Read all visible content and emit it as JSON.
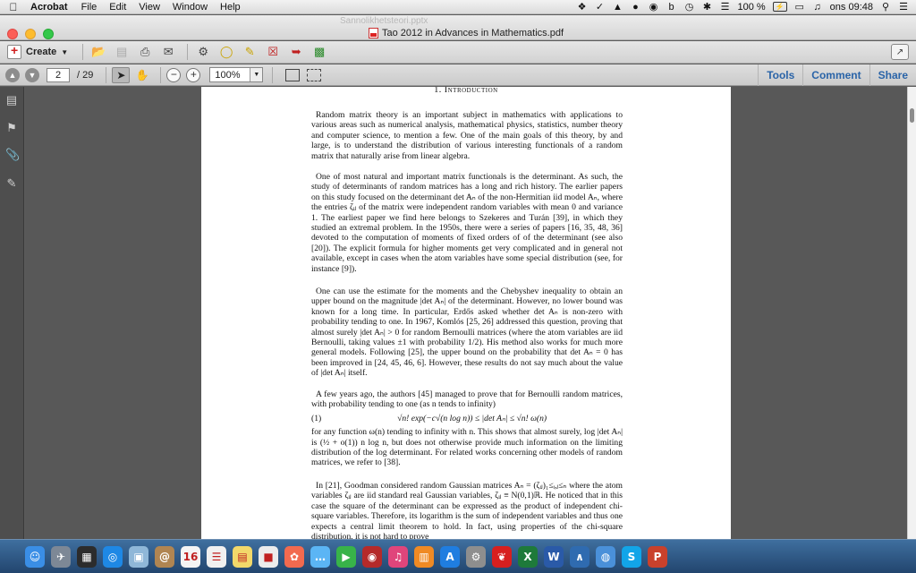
{
  "menubar": {
    "app_name": "Acrobat",
    "menus": [
      "File",
      "Edit",
      "View",
      "Window",
      "Help"
    ],
    "status": {
      "battery": "100 %",
      "battery_badge": "⚡",
      "clock": "ons 09:48"
    }
  },
  "window": {
    "ghost_title": "Sannolikhetsteori.pptx",
    "title": "Tao 2012 in Advances in Mathematics.pdf"
  },
  "toolbar": {
    "create_label": "Create",
    "tools": [
      "open-folder-icon",
      "save-icon",
      "print-icon",
      "email-icon",
      "gear-icon",
      "comment-icon",
      "sign-icon",
      "pdf-delete-icon",
      "pdf-export-icon",
      "pdf-combine-icon"
    ]
  },
  "nav": {
    "current_page": "2",
    "page_total": "/ 29",
    "zoom": "100%",
    "right_tabs": [
      "Tools",
      "Comment",
      "Share"
    ]
  },
  "document": {
    "heading": "1. Introduction",
    "p1": "Random matrix theory is an important subject in mathematics with applications to various areas such as numerical analysis, mathematical physics, statistics, number theory and computer science, to mention a few. One of the main goals of this theory, by and large, is to understand the distribution of various interesting functionals of a random matrix that naturally arise from linear algebra.",
    "p2": "One of most natural and important matrix functionals is the determinant. As such, the study of determinants of random matrices has a long and rich history. The earlier papers on this study focused on the determinant det Aₙ of the non-Hermitian iid model Aₙ, where the entries ζᵢⱼ of the matrix were independent random variables with mean 0 and variance 1. The earliest paper we find here belongs to Szekeres and Turán [39], in which they studied an extremal problem. In the 1950s, there were a series of papers [16, 35, 48, 36] devoted to the computation of moments of fixed orders of of the determinant (see also [20]). The explicit formula for higher moments get very complicated and in general not available, except in cases when the atom variables have some special distribution (see, for instance [9]).",
    "p3": "One can use the estimate for the moments and the Chebyshev inequality to obtain an upper bound on the magnitude |det Aₙ| of the determinant. However, no lower bound was known for a long time. In particular, Erdős asked whether det Aₙ is non-zero with probability tending to one. In 1967, Komlós [25, 26] addressed this question, proving that almost surely |det Aₙ| > 0 for random Bernoulli matrices (where the atom variables are iid Bernoulli, taking values ±1 with probability 1/2). His method also works for much more general models. Following [25], the upper bound on the probability that det Aₙ = 0 has been improved in [24, 45, 46, 6]. However, these results do not say much about the value of |det Aₙ| itself.",
    "p4_intro": "A few years ago, the authors [45] managed to prove that for Bernoulli random matrices, with probability tending to one (as n tends to infinity)",
    "eq_number": "(1)",
    "eq_body": "√n! exp(−c√(n log n)) ≤ |det Aₙ| ≤ √n! ω(n)",
    "p4_rest": "for any function ω(n) tending to infinity with n. This shows that almost surely, log |det Aₙ| is (½ + o(1)) n log n, but does not otherwise provide much information on the limiting distribution of the log determinant. For related works concerning other models of random matrices, we refer to [38].",
    "p5": "In [21], Goodman considered random Gaussian matrices Aₙ = (ζᵢⱼ)₁≤ᵢ,ⱼ≤ₙ where the atom variables ζᵢⱼ are iid standard real Gaussian variables, ζᵢⱼ ≡ N(0,1)ℝ. He noticed that in this case the square of the determinant can be expressed as the product of independent chi-square variables. Therefore, its logarithm is the sum of independent variables and thus one expects a central limit theorem to hold. In fact, using properties of the chi-square distribution, it is not hard to prove"
  },
  "dock": {
    "apps": [
      {
        "name": "finder-icon",
        "glyph": "☺",
        "color": "#3a8ee6"
      },
      {
        "name": "launchpad-icon",
        "glyph": "✈",
        "color": "#7d8896"
      },
      {
        "name": "dashboard-icon",
        "glyph": "▦",
        "color": "#2c2c2c"
      },
      {
        "name": "safari-icon",
        "glyph": "◎",
        "color": "#1e88e5"
      },
      {
        "name": "preview-icon",
        "glyph": "▣",
        "color": "#8fb7d8"
      },
      {
        "name": "contacts-icon",
        "glyph": "@",
        "color": "#b08552"
      },
      {
        "name": "calendar-icon",
        "glyph": "16",
        "color": "#f4f4f4"
      },
      {
        "name": "reminders-icon",
        "glyph": "☰",
        "color": "#f0f0f0"
      },
      {
        "name": "notes-icon",
        "glyph": "▤",
        "color": "#f2d86a"
      },
      {
        "name": "stickies-icon",
        "glyph": "■",
        "color": "#ececec"
      },
      {
        "name": "photos-icon",
        "glyph": "✿",
        "color": "#f26a4f"
      },
      {
        "name": "messages-icon",
        "glyph": "…",
        "color": "#5bb5f5"
      },
      {
        "name": "facetime-icon",
        "glyph": "▶",
        "color": "#38b349"
      },
      {
        "name": "photo-booth-icon",
        "glyph": "◉",
        "color": "#b52a2a"
      },
      {
        "name": "itunes-icon",
        "glyph": "♫",
        "color": "#e0457b"
      },
      {
        "name": "ibooks-icon",
        "glyph": "▥",
        "color": "#f08a24"
      },
      {
        "name": "app-store-icon",
        "glyph": "A",
        "color": "#1f7de0"
      },
      {
        "name": "system-preferences-icon",
        "glyph": "⚙",
        "color": "#8e8e8e"
      },
      {
        "name": "acrobat-icon",
        "glyph": "❦",
        "color": "#d71f1f"
      },
      {
        "name": "excel-icon",
        "glyph": "X",
        "color": "#1e7a3a"
      },
      {
        "name": "word-icon",
        "glyph": "W",
        "color": "#2a5aa8"
      },
      {
        "name": "matlab-icon",
        "glyph": "∧",
        "color": "#2f6bb0"
      },
      {
        "name": "network-icon",
        "glyph": "◍",
        "color": "#4a90d9"
      },
      {
        "name": "skype-icon",
        "glyph": "S",
        "color": "#12a5e8"
      },
      {
        "name": "powerpoint-icon",
        "glyph": "P",
        "color": "#c9412c"
      }
    ]
  }
}
